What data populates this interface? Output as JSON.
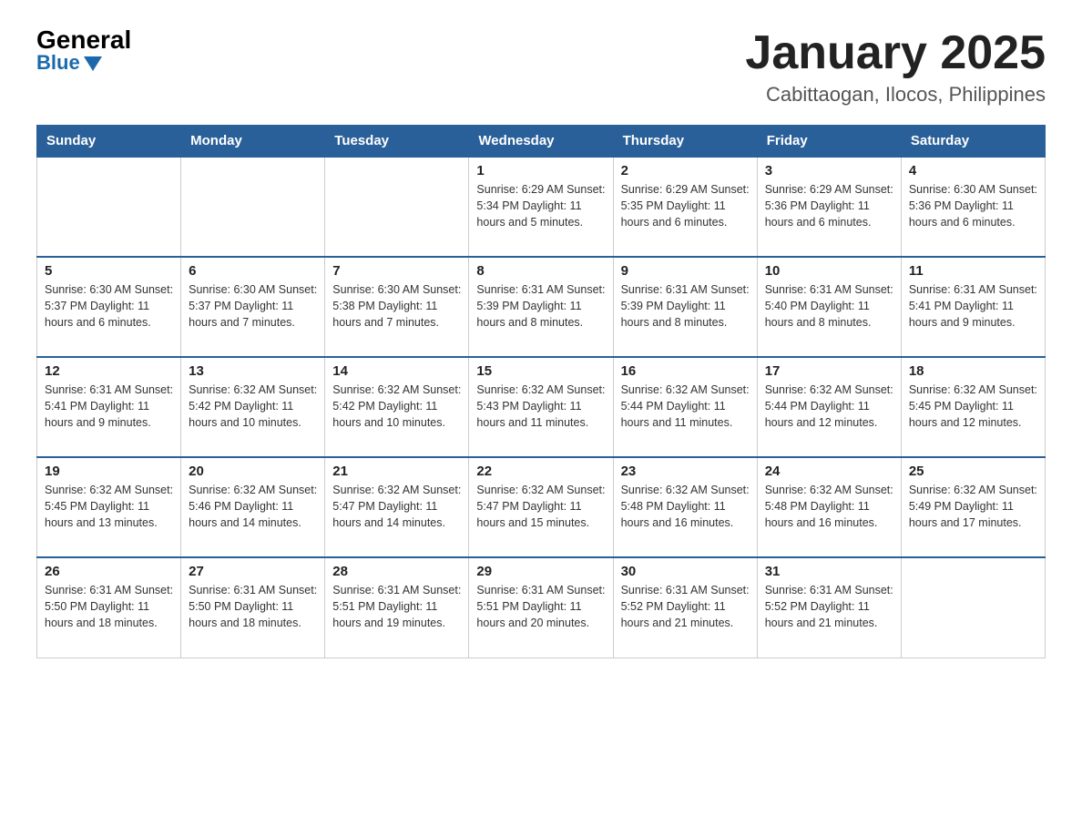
{
  "logo": {
    "general": "General",
    "blue": "Blue"
  },
  "title": "January 2025",
  "subtitle": "Cabittaogan, Ilocos, Philippines",
  "days_of_week": [
    "Sunday",
    "Monday",
    "Tuesday",
    "Wednesday",
    "Thursday",
    "Friday",
    "Saturday"
  ],
  "weeks": [
    [
      {
        "day": "",
        "info": ""
      },
      {
        "day": "",
        "info": ""
      },
      {
        "day": "",
        "info": ""
      },
      {
        "day": "1",
        "info": "Sunrise: 6:29 AM\nSunset: 5:34 PM\nDaylight: 11 hours and 5 minutes."
      },
      {
        "day": "2",
        "info": "Sunrise: 6:29 AM\nSunset: 5:35 PM\nDaylight: 11 hours and 6 minutes."
      },
      {
        "day": "3",
        "info": "Sunrise: 6:29 AM\nSunset: 5:36 PM\nDaylight: 11 hours and 6 minutes."
      },
      {
        "day": "4",
        "info": "Sunrise: 6:30 AM\nSunset: 5:36 PM\nDaylight: 11 hours and 6 minutes."
      }
    ],
    [
      {
        "day": "5",
        "info": "Sunrise: 6:30 AM\nSunset: 5:37 PM\nDaylight: 11 hours and 6 minutes."
      },
      {
        "day": "6",
        "info": "Sunrise: 6:30 AM\nSunset: 5:37 PM\nDaylight: 11 hours and 7 minutes."
      },
      {
        "day": "7",
        "info": "Sunrise: 6:30 AM\nSunset: 5:38 PM\nDaylight: 11 hours and 7 minutes."
      },
      {
        "day": "8",
        "info": "Sunrise: 6:31 AM\nSunset: 5:39 PM\nDaylight: 11 hours and 8 minutes."
      },
      {
        "day": "9",
        "info": "Sunrise: 6:31 AM\nSunset: 5:39 PM\nDaylight: 11 hours and 8 minutes."
      },
      {
        "day": "10",
        "info": "Sunrise: 6:31 AM\nSunset: 5:40 PM\nDaylight: 11 hours and 8 minutes."
      },
      {
        "day": "11",
        "info": "Sunrise: 6:31 AM\nSunset: 5:41 PM\nDaylight: 11 hours and 9 minutes."
      }
    ],
    [
      {
        "day": "12",
        "info": "Sunrise: 6:31 AM\nSunset: 5:41 PM\nDaylight: 11 hours and 9 minutes."
      },
      {
        "day": "13",
        "info": "Sunrise: 6:32 AM\nSunset: 5:42 PM\nDaylight: 11 hours and 10 minutes."
      },
      {
        "day": "14",
        "info": "Sunrise: 6:32 AM\nSunset: 5:42 PM\nDaylight: 11 hours and 10 minutes."
      },
      {
        "day": "15",
        "info": "Sunrise: 6:32 AM\nSunset: 5:43 PM\nDaylight: 11 hours and 11 minutes."
      },
      {
        "day": "16",
        "info": "Sunrise: 6:32 AM\nSunset: 5:44 PM\nDaylight: 11 hours and 11 minutes."
      },
      {
        "day": "17",
        "info": "Sunrise: 6:32 AM\nSunset: 5:44 PM\nDaylight: 11 hours and 12 minutes."
      },
      {
        "day": "18",
        "info": "Sunrise: 6:32 AM\nSunset: 5:45 PM\nDaylight: 11 hours and 12 minutes."
      }
    ],
    [
      {
        "day": "19",
        "info": "Sunrise: 6:32 AM\nSunset: 5:45 PM\nDaylight: 11 hours and 13 minutes."
      },
      {
        "day": "20",
        "info": "Sunrise: 6:32 AM\nSunset: 5:46 PM\nDaylight: 11 hours and 14 minutes."
      },
      {
        "day": "21",
        "info": "Sunrise: 6:32 AM\nSunset: 5:47 PM\nDaylight: 11 hours and 14 minutes."
      },
      {
        "day": "22",
        "info": "Sunrise: 6:32 AM\nSunset: 5:47 PM\nDaylight: 11 hours and 15 minutes."
      },
      {
        "day": "23",
        "info": "Sunrise: 6:32 AM\nSunset: 5:48 PM\nDaylight: 11 hours and 16 minutes."
      },
      {
        "day": "24",
        "info": "Sunrise: 6:32 AM\nSunset: 5:48 PM\nDaylight: 11 hours and 16 minutes."
      },
      {
        "day": "25",
        "info": "Sunrise: 6:32 AM\nSunset: 5:49 PM\nDaylight: 11 hours and 17 minutes."
      }
    ],
    [
      {
        "day": "26",
        "info": "Sunrise: 6:31 AM\nSunset: 5:50 PM\nDaylight: 11 hours and 18 minutes."
      },
      {
        "day": "27",
        "info": "Sunrise: 6:31 AM\nSunset: 5:50 PM\nDaylight: 11 hours and 18 minutes."
      },
      {
        "day": "28",
        "info": "Sunrise: 6:31 AM\nSunset: 5:51 PM\nDaylight: 11 hours and 19 minutes."
      },
      {
        "day": "29",
        "info": "Sunrise: 6:31 AM\nSunset: 5:51 PM\nDaylight: 11 hours and 20 minutes."
      },
      {
        "day": "30",
        "info": "Sunrise: 6:31 AM\nSunset: 5:52 PM\nDaylight: 11 hours and 21 minutes."
      },
      {
        "day": "31",
        "info": "Sunrise: 6:31 AM\nSunset: 5:52 PM\nDaylight: 11 hours and 21 minutes."
      },
      {
        "day": "",
        "info": ""
      }
    ]
  ]
}
